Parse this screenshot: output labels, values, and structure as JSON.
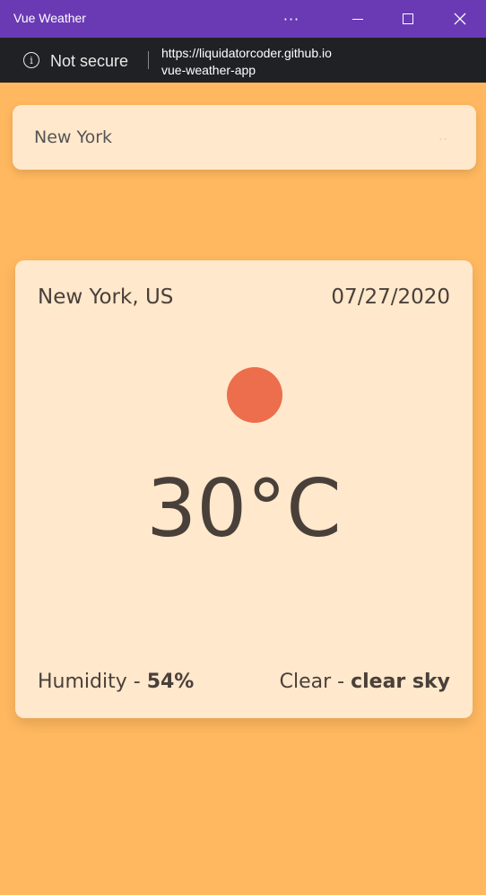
{
  "window": {
    "title": "Vue Weather",
    "more": "···"
  },
  "addressbar": {
    "security_label": "Not secure",
    "url_line1": "https://liquidatorcoder.github.io",
    "url_line2": "vue-weather-app"
  },
  "search": {
    "value": "New York",
    "placeholder": ""
  },
  "weather": {
    "location": "New York, US",
    "date": "07/27/2020",
    "temperature": "30°C",
    "humidity_label": "Humidity - ",
    "humidity_value": "54%",
    "condition_main": "Clear - ",
    "condition_desc": "clear sky",
    "icon": "sun-icon"
  },
  "colors": {
    "background": "#ffb85f",
    "card": "#ffe8cc",
    "titlebar": "#6a3ab5",
    "sun": "#ec6e4c",
    "text": "#4a403a"
  }
}
